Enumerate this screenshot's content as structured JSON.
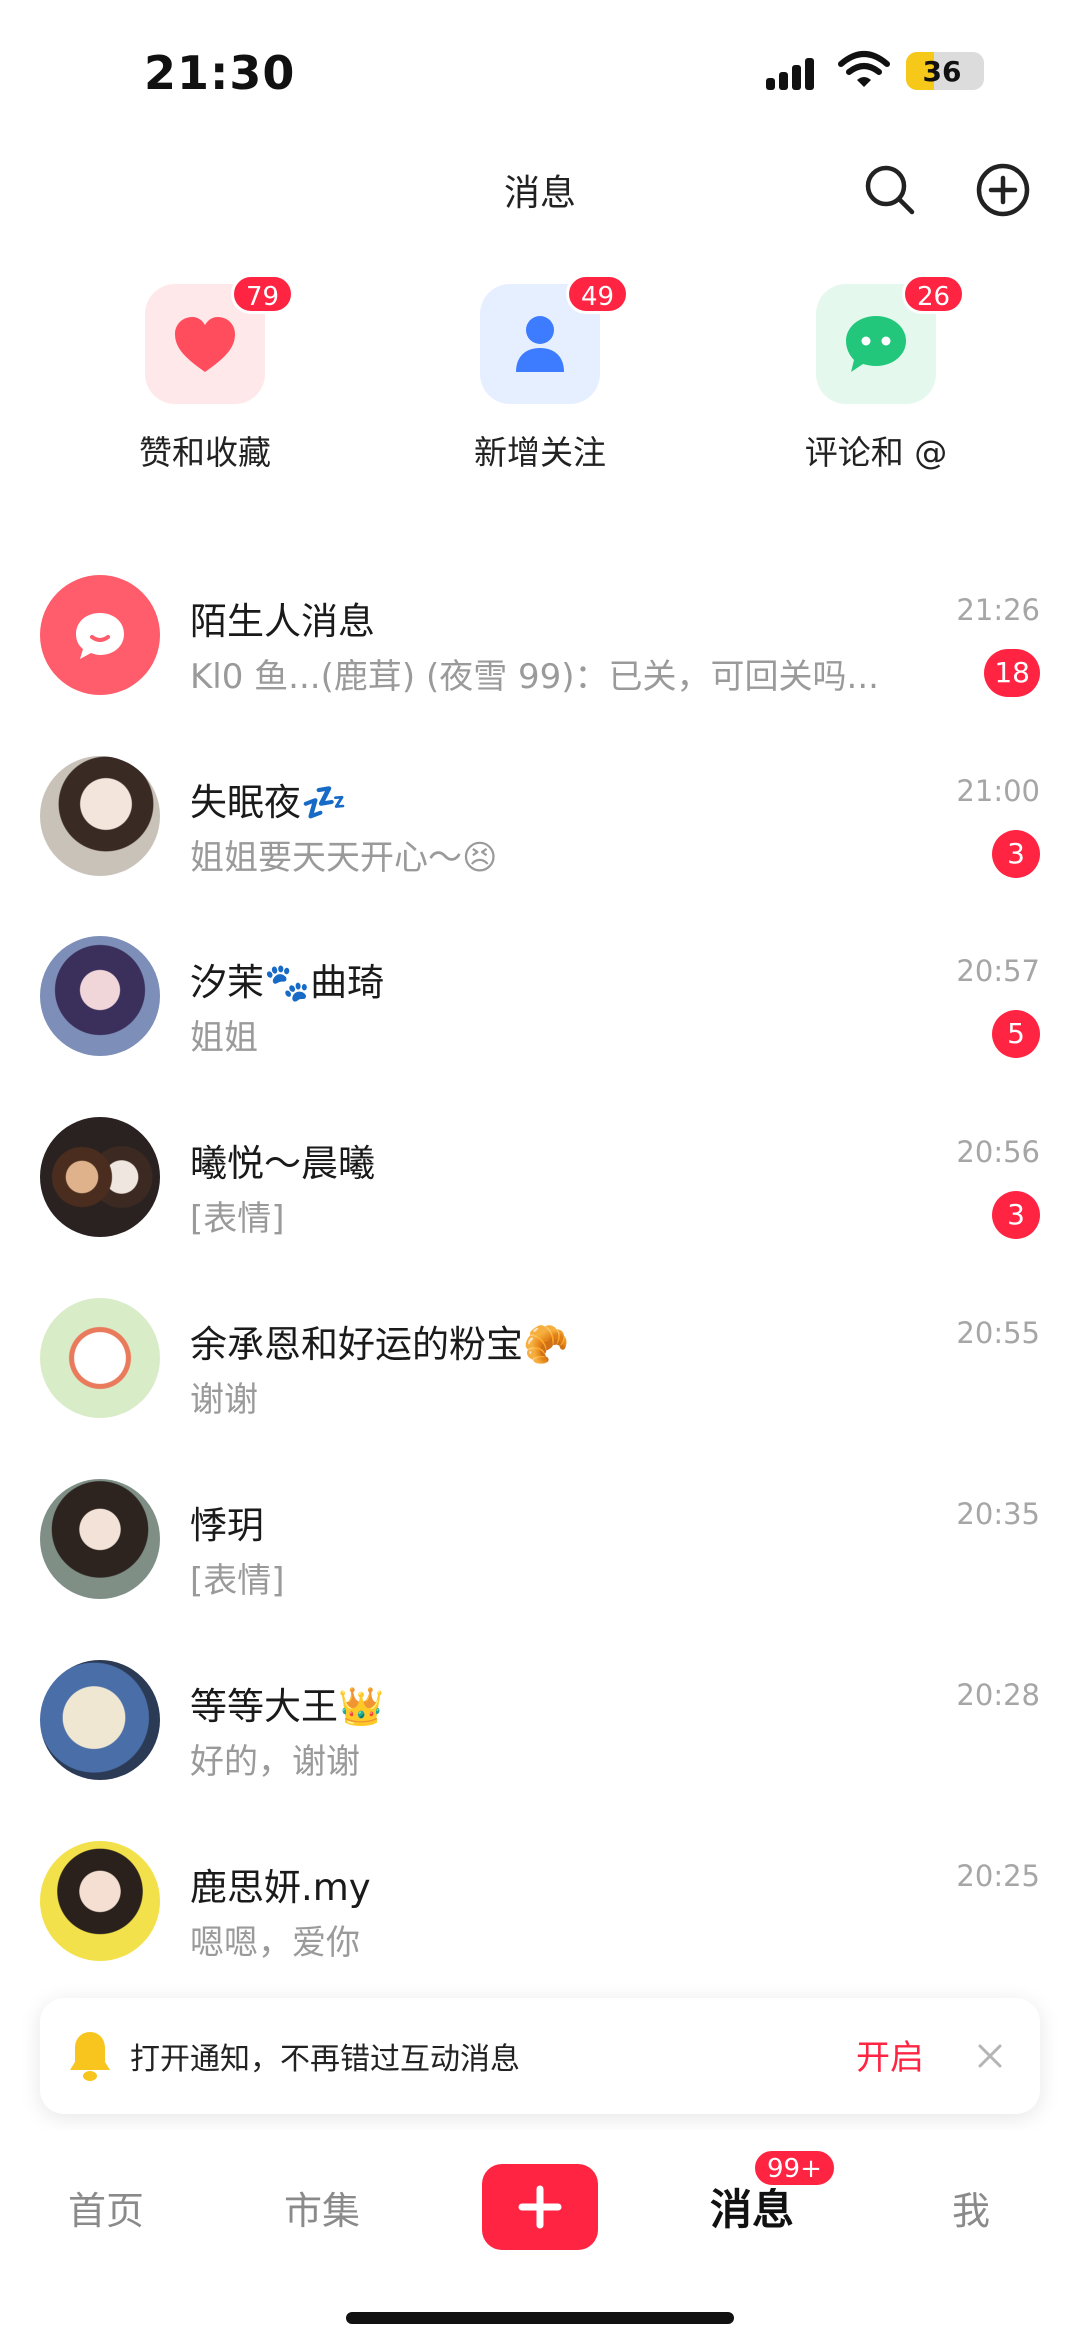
{
  "status_bar": {
    "time": "21:30",
    "battery": "36",
    "battery_level": 0.36
  },
  "header": {
    "title": "消息",
    "search_icon": "search-icon",
    "add_icon": "plus-circle-icon"
  },
  "quick_actions": [
    {
      "label": "赞和收藏",
      "badge": "79",
      "icon": "heart-icon",
      "color": "#ff4d5e"
    },
    {
      "label": "新增关注",
      "badge": "49",
      "icon": "person-icon",
      "color": "#3d7bff"
    },
    {
      "label": "评论和 @",
      "badge": "26",
      "icon": "chat-bubble-icon",
      "color": "#23c77b"
    }
  ],
  "chats": [
    {
      "name": "陌生人消息",
      "preview": "Kl0 鱼...(鹿茸) (夜雪 99)：已关，可回关吗...",
      "time": "21:26",
      "unread": "18"
    },
    {
      "name": "失眠夜💤",
      "preview": "姐姐要天天开心～😣",
      "time": "21:00",
      "unread": "3"
    },
    {
      "name": "汐茉🐾曲琦",
      "preview": "姐姐",
      "time": "20:57",
      "unread": "5"
    },
    {
      "name": "曦悦～晨曦",
      "preview": "[表情]",
      "time": "20:56",
      "unread": "3"
    },
    {
      "name": "余承恩和好运的粉宝🥐",
      "preview": "谢谢",
      "time": "20:55",
      "unread": ""
    },
    {
      "name": "悸玥",
      "preview": "[表情]",
      "time": "20:35",
      "unread": ""
    },
    {
      "name": "等等大王👑",
      "preview": "好的，谢谢",
      "time": "20:28",
      "unread": ""
    },
    {
      "name": "鹿思妍.my",
      "preview": "嗯嗯，爱你",
      "time": "20:25",
      "unread": ""
    }
  ],
  "notice": {
    "text": "打开通知，不再错过互动消息",
    "action": "开启"
  },
  "tabbar": {
    "home": "首页",
    "market": "市集",
    "messages": "消息",
    "messages_badge": "99+",
    "me": "我"
  },
  "colors": {
    "accent": "#ff2442"
  }
}
